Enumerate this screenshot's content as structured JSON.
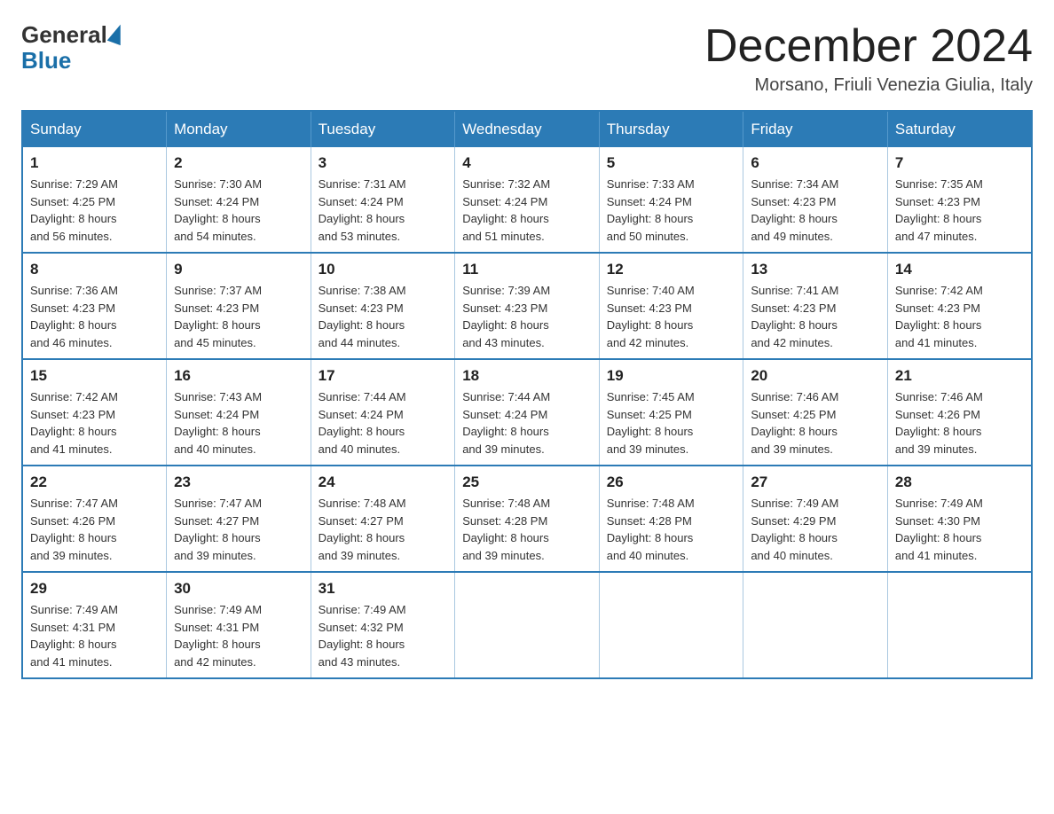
{
  "header": {
    "logo_general": "General",
    "logo_blue": "Blue",
    "month_title": "December 2024",
    "location": "Morsano, Friuli Venezia Giulia, Italy"
  },
  "days_of_week": [
    "Sunday",
    "Monday",
    "Tuesday",
    "Wednesday",
    "Thursday",
    "Friday",
    "Saturday"
  ],
  "weeks": [
    [
      {
        "day": "1",
        "sunrise": "Sunrise: 7:29 AM",
        "sunset": "Sunset: 4:25 PM",
        "daylight": "Daylight: 8 hours",
        "minutes": "and 56 minutes."
      },
      {
        "day": "2",
        "sunrise": "Sunrise: 7:30 AM",
        "sunset": "Sunset: 4:24 PM",
        "daylight": "Daylight: 8 hours",
        "minutes": "and 54 minutes."
      },
      {
        "day": "3",
        "sunrise": "Sunrise: 7:31 AM",
        "sunset": "Sunset: 4:24 PM",
        "daylight": "Daylight: 8 hours",
        "minutes": "and 53 minutes."
      },
      {
        "day": "4",
        "sunrise": "Sunrise: 7:32 AM",
        "sunset": "Sunset: 4:24 PM",
        "daylight": "Daylight: 8 hours",
        "minutes": "and 51 minutes."
      },
      {
        "day": "5",
        "sunrise": "Sunrise: 7:33 AM",
        "sunset": "Sunset: 4:24 PM",
        "daylight": "Daylight: 8 hours",
        "minutes": "and 50 minutes."
      },
      {
        "day": "6",
        "sunrise": "Sunrise: 7:34 AM",
        "sunset": "Sunset: 4:23 PM",
        "daylight": "Daylight: 8 hours",
        "minutes": "and 49 minutes."
      },
      {
        "day": "7",
        "sunrise": "Sunrise: 7:35 AM",
        "sunset": "Sunset: 4:23 PM",
        "daylight": "Daylight: 8 hours",
        "minutes": "and 47 minutes."
      }
    ],
    [
      {
        "day": "8",
        "sunrise": "Sunrise: 7:36 AM",
        "sunset": "Sunset: 4:23 PM",
        "daylight": "Daylight: 8 hours",
        "minutes": "and 46 minutes."
      },
      {
        "day": "9",
        "sunrise": "Sunrise: 7:37 AM",
        "sunset": "Sunset: 4:23 PM",
        "daylight": "Daylight: 8 hours",
        "minutes": "and 45 minutes."
      },
      {
        "day": "10",
        "sunrise": "Sunrise: 7:38 AM",
        "sunset": "Sunset: 4:23 PM",
        "daylight": "Daylight: 8 hours",
        "minutes": "and 44 minutes."
      },
      {
        "day": "11",
        "sunrise": "Sunrise: 7:39 AM",
        "sunset": "Sunset: 4:23 PM",
        "daylight": "Daylight: 8 hours",
        "minutes": "and 43 minutes."
      },
      {
        "day": "12",
        "sunrise": "Sunrise: 7:40 AM",
        "sunset": "Sunset: 4:23 PM",
        "daylight": "Daylight: 8 hours",
        "minutes": "and 42 minutes."
      },
      {
        "day": "13",
        "sunrise": "Sunrise: 7:41 AM",
        "sunset": "Sunset: 4:23 PM",
        "daylight": "Daylight: 8 hours",
        "minutes": "and 42 minutes."
      },
      {
        "day": "14",
        "sunrise": "Sunrise: 7:42 AM",
        "sunset": "Sunset: 4:23 PM",
        "daylight": "Daylight: 8 hours",
        "minutes": "and 41 minutes."
      }
    ],
    [
      {
        "day": "15",
        "sunrise": "Sunrise: 7:42 AM",
        "sunset": "Sunset: 4:23 PM",
        "daylight": "Daylight: 8 hours",
        "minutes": "and 41 minutes."
      },
      {
        "day": "16",
        "sunrise": "Sunrise: 7:43 AM",
        "sunset": "Sunset: 4:24 PM",
        "daylight": "Daylight: 8 hours",
        "minutes": "and 40 minutes."
      },
      {
        "day": "17",
        "sunrise": "Sunrise: 7:44 AM",
        "sunset": "Sunset: 4:24 PM",
        "daylight": "Daylight: 8 hours",
        "minutes": "and 40 minutes."
      },
      {
        "day": "18",
        "sunrise": "Sunrise: 7:44 AM",
        "sunset": "Sunset: 4:24 PM",
        "daylight": "Daylight: 8 hours",
        "minutes": "and 39 minutes."
      },
      {
        "day": "19",
        "sunrise": "Sunrise: 7:45 AM",
        "sunset": "Sunset: 4:25 PM",
        "daylight": "Daylight: 8 hours",
        "minutes": "and 39 minutes."
      },
      {
        "day": "20",
        "sunrise": "Sunrise: 7:46 AM",
        "sunset": "Sunset: 4:25 PM",
        "daylight": "Daylight: 8 hours",
        "minutes": "and 39 minutes."
      },
      {
        "day": "21",
        "sunrise": "Sunrise: 7:46 AM",
        "sunset": "Sunset: 4:26 PM",
        "daylight": "Daylight: 8 hours",
        "minutes": "and 39 minutes."
      }
    ],
    [
      {
        "day": "22",
        "sunrise": "Sunrise: 7:47 AM",
        "sunset": "Sunset: 4:26 PM",
        "daylight": "Daylight: 8 hours",
        "minutes": "and 39 minutes."
      },
      {
        "day": "23",
        "sunrise": "Sunrise: 7:47 AM",
        "sunset": "Sunset: 4:27 PM",
        "daylight": "Daylight: 8 hours",
        "minutes": "and 39 minutes."
      },
      {
        "day": "24",
        "sunrise": "Sunrise: 7:48 AM",
        "sunset": "Sunset: 4:27 PM",
        "daylight": "Daylight: 8 hours",
        "minutes": "and 39 minutes."
      },
      {
        "day": "25",
        "sunrise": "Sunrise: 7:48 AM",
        "sunset": "Sunset: 4:28 PM",
        "daylight": "Daylight: 8 hours",
        "minutes": "and 39 minutes."
      },
      {
        "day": "26",
        "sunrise": "Sunrise: 7:48 AM",
        "sunset": "Sunset: 4:28 PM",
        "daylight": "Daylight: 8 hours",
        "minutes": "and 40 minutes."
      },
      {
        "day": "27",
        "sunrise": "Sunrise: 7:49 AM",
        "sunset": "Sunset: 4:29 PM",
        "daylight": "Daylight: 8 hours",
        "minutes": "and 40 minutes."
      },
      {
        "day": "28",
        "sunrise": "Sunrise: 7:49 AM",
        "sunset": "Sunset: 4:30 PM",
        "daylight": "Daylight: 8 hours",
        "minutes": "and 41 minutes."
      }
    ],
    [
      {
        "day": "29",
        "sunrise": "Sunrise: 7:49 AM",
        "sunset": "Sunset: 4:31 PM",
        "daylight": "Daylight: 8 hours",
        "minutes": "and 41 minutes."
      },
      {
        "day": "30",
        "sunrise": "Sunrise: 7:49 AM",
        "sunset": "Sunset: 4:31 PM",
        "daylight": "Daylight: 8 hours",
        "minutes": "and 42 minutes."
      },
      {
        "day": "31",
        "sunrise": "Sunrise: 7:49 AM",
        "sunset": "Sunset: 4:32 PM",
        "daylight": "Daylight: 8 hours",
        "minutes": "and 43 minutes."
      },
      null,
      null,
      null,
      null
    ]
  ]
}
